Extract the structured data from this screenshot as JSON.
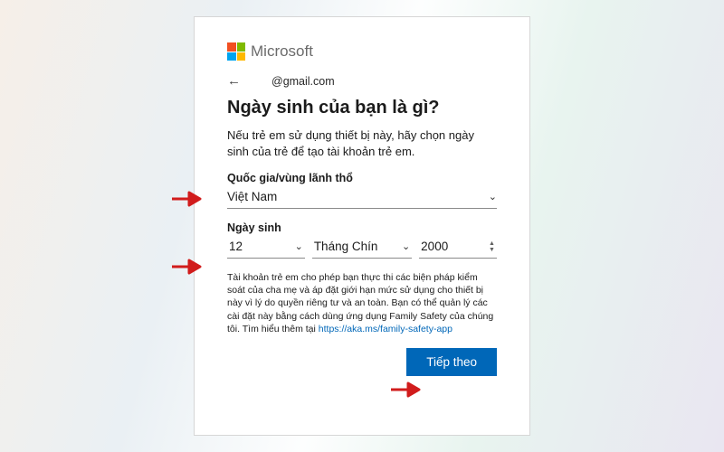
{
  "brand": {
    "name": "Microsoft"
  },
  "identity": {
    "back_glyph": "←",
    "email": "@gmail.com"
  },
  "title": "Ngày sinh của bạn là gì?",
  "description": "Nếu trẻ em sử dụng thiết bị này, hãy chọn ngày sinh của trẻ để tạo tài khoản trẻ em.",
  "country": {
    "label": "Quốc gia/vùng lãnh thổ",
    "value": "Việt Nam"
  },
  "dob": {
    "label": "Ngày sinh",
    "day": "12",
    "month": "Tháng Chín",
    "year": "2000"
  },
  "fineprint": {
    "text_before": "Tài khoản trẻ em cho phép bạn thực thi các biện pháp kiểm soát của cha mẹ và áp đặt giới hạn mức sử dụng cho thiết bị này vì lý do quyền riêng tư và an toàn. Bạn có thể quản lý các cài đặt này bằng cách dùng ứng dụng Family Safety của chúng tôi. Tìm hiểu thêm tại ",
    "link_text": "https://aka.ms/family-safety-app"
  },
  "buttons": {
    "next": "Tiếp theo"
  },
  "glyphs": {
    "chevron_down": "⌄",
    "spin_up": "▲",
    "spin_down": "▼"
  }
}
